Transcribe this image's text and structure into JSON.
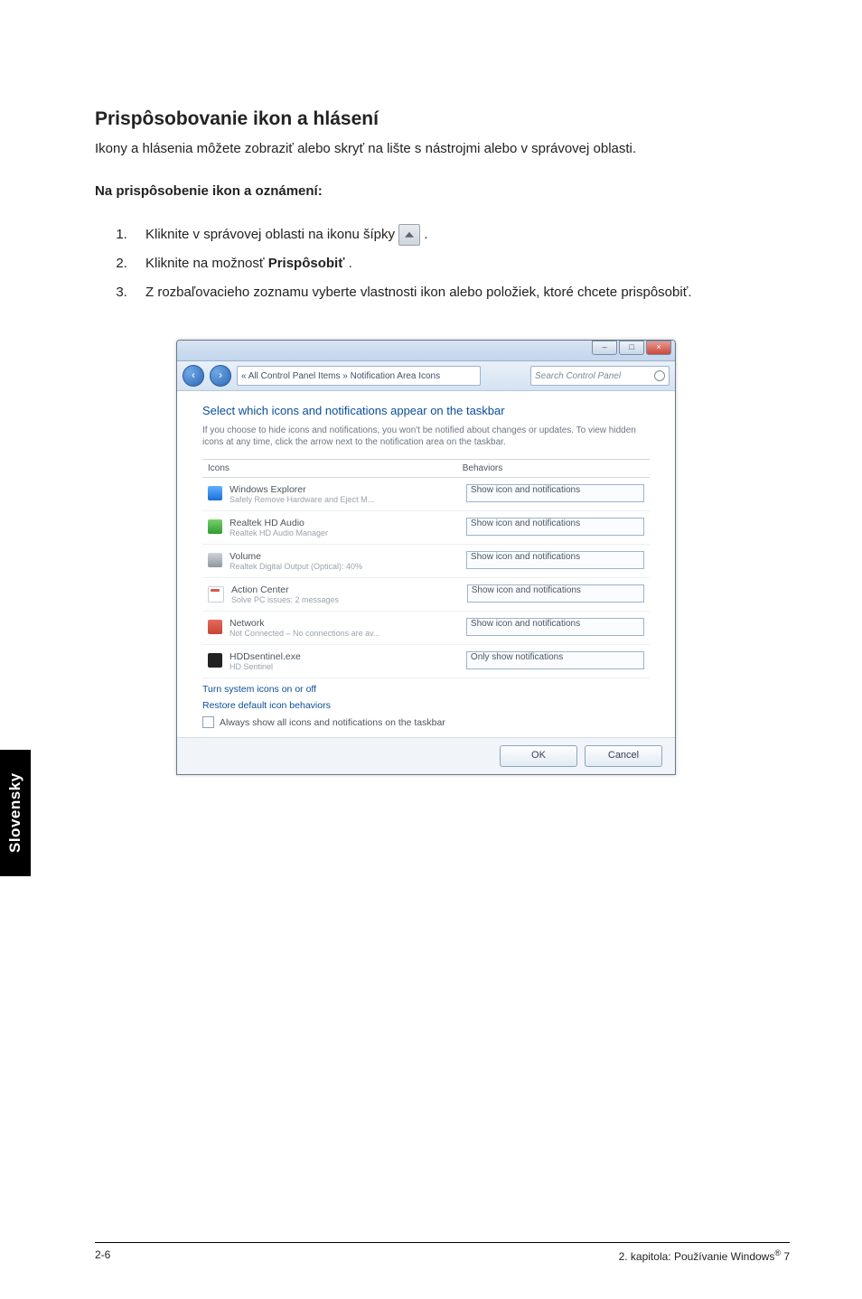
{
  "page": {
    "title": "Prispôsobovanie ikon a hlásení",
    "intro": "Ikony a hlásenia môžete zobraziť alebo skryť na lište s nástrojmi alebo v správovej oblasti.",
    "subhead": "Na prispôsobenie ikon a oznámení:",
    "steps": {
      "s1a": "Kliknite v správovej oblasti na ikonu šípky ",
      "s1b": ".",
      "s2a": "Kliknite na možnosť ",
      "s2b": "Prispôsobiť",
      "s2c": ".",
      "s3": "Z rozbaľovacieho zoznamu vyberte vlastnosti ikon alebo položiek, ktoré chcete prispôsobiť."
    }
  },
  "sidetab": "Slovensky",
  "footer": {
    "left": "2-6",
    "right_a": "2. kapitola: Používanie Windows",
    "right_b": " 7"
  },
  "win": {
    "title_buttons": {
      "min": "–",
      "max": "□",
      "close": "×"
    },
    "nav_back": "‹",
    "nav_fwd": "›",
    "address": "« All Control Panel Items » Notification Area Icons",
    "search_placeholder": "Search Control Panel",
    "heading": "Select which icons and notifications appear on the taskbar",
    "desc": "If you choose to hide icons and notifications, you won't be notified about changes or updates. To view hidden icons at any time, click the arrow next to the notification area on the taskbar.",
    "th_icons": "Icons",
    "th_beh": "Behaviors",
    "rows": [
      {
        "name": "Windows Explorer",
        "sub": "Safely Remove Hardware and Eject M...",
        "sel": "Show icon and notifications"
      },
      {
        "name": "Realtek HD Audio",
        "sub": "Realtek HD Audio Manager",
        "sel": "Show icon and notifications"
      },
      {
        "name": "Volume",
        "sub": "Realtek Digital Output (Optical): 40%",
        "sel": "Show icon and notifications"
      },
      {
        "name": "Action Center",
        "sub": "Solve PC issues: 2 messages",
        "sel": "Show icon and notifications"
      },
      {
        "name": "Network",
        "sub": "Not Connected – No connections are av...",
        "sel": "Show icon and notifications"
      },
      {
        "name": "HDDsentinel.exe",
        "sub": "HD Sentinel",
        "sel": "Only show notifications"
      }
    ],
    "link1": "Turn system icons on or off",
    "link2": "Restore default icon behaviors",
    "chk_label": "Always show all icons and notifications on the taskbar",
    "ok": "OK",
    "cancel": "Cancel"
  }
}
